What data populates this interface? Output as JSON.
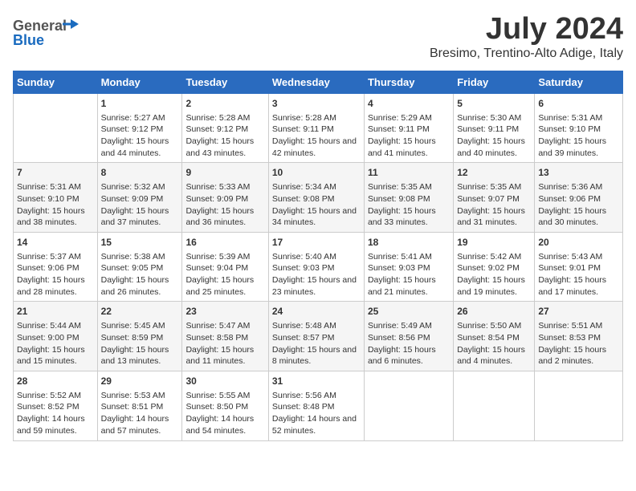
{
  "header": {
    "logo_line1": "General",
    "logo_line2": "Blue",
    "month": "July 2024",
    "location": "Bresimo, Trentino-Alto Adige, Italy"
  },
  "weekdays": [
    "Sunday",
    "Monday",
    "Tuesday",
    "Wednesday",
    "Thursday",
    "Friday",
    "Saturday"
  ],
  "weeks": [
    [
      {
        "day": "",
        "content": ""
      },
      {
        "day": "1",
        "sunrise": "Sunrise: 5:27 AM",
        "sunset": "Sunset: 9:12 PM",
        "daylight": "Daylight: 15 hours and 44 minutes."
      },
      {
        "day": "2",
        "sunrise": "Sunrise: 5:28 AM",
        "sunset": "Sunset: 9:12 PM",
        "daylight": "Daylight: 15 hours and 43 minutes."
      },
      {
        "day": "3",
        "sunrise": "Sunrise: 5:28 AM",
        "sunset": "Sunset: 9:11 PM",
        "daylight": "Daylight: 15 hours and 42 minutes."
      },
      {
        "day": "4",
        "sunrise": "Sunrise: 5:29 AM",
        "sunset": "Sunset: 9:11 PM",
        "daylight": "Daylight: 15 hours and 41 minutes."
      },
      {
        "day": "5",
        "sunrise": "Sunrise: 5:30 AM",
        "sunset": "Sunset: 9:11 PM",
        "daylight": "Daylight: 15 hours and 40 minutes."
      },
      {
        "day": "6",
        "sunrise": "Sunrise: 5:31 AM",
        "sunset": "Sunset: 9:10 PM",
        "daylight": "Daylight: 15 hours and 39 minutes."
      }
    ],
    [
      {
        "day": "7",
        "sunrise": "Sunrise: 5:31 AM",
        "sunset": "Sunset: 9:10 PM",
        "daylight": "Daylight: 15 hours and 38 minutes."
      },
      {
        "day": "8",
        "sunrise": "Sunrise: 5:32 AM",
        "sunset": "Sunset: 9:09 PM",
        "daylight": "Daylight: 15 hours and 37 minutes."
      },
      {
        "day": "9",
        "sunrise": "Sunrise: 5:33 AM",
        "sunset": "Sunset: 9:09 PM",
        "daylight": "Daylight: 15 hours and 36 minutes."
      },
      {
        "day": "10",
        "sunrise": "Sunrise: 5:34 AM",
        "sunset": "Sunset: 9:08 PM",
        "daylight": "Daylight: 15 hours and 34 minutes."
      },
      {
        "day": "11",
        "sunrise": "Sunrise: 5:35 AM",
        "sunset": "Sunset: 9:08 PM",
        "daylight": "Daylight: 15 hours and 33 minutes."
      },
      {
        "day": "12",
        "sunrise": "Sunrise: 5:35 AM",
        "sunset": "Sunset: 9:07 PM",
        "daylight": "Daylight: 15 hours and 31 minutes."
      },
      {
        "day": "13",
        "sunrise": "Sunrise: 5:36 AM",
        "sunset": "Sunset: 9:06 PM",
        "daylight": "Daylight: 15 hours and 30 minutes."
      }
    ],
    [
      {
        "day": "14",
        "sunrise": "Sunrise: 5:37 AM",
        "sunset": "Sunset: 9:06 PM",
        "daylight": "Daylight: 15 hours and 28 minutes."
      },
      {
        "day": "15",
        "sunrise": "Sunrise: 5:38 AM",
        "sunset": "Sunset: 9:05 PM",
        "daylight": "Daylight: 15 hours and 26 minutes."
      },
      {
        "day": "16",
        "sunrise": "Sunrise: 5:39 AM",
        "sunset": "Sunset: 9:04 PM",
        "daylight": "Daylight: 15 hours and 25 minutes."
      },
      {
        "day": "17",
        "sunrise": "Sunrise: 5:40 AM",
        "sunset": "Sunset: 9:03 PM",
        "daylight": "Daylight: 15 hours and 23 minutes."
      },
      {
        "day": "18",
        "sunrise": "Sunrise: 5:41 AM",
        "sunset": "Sunset: 9:03 PM",
        "daylight": "Daylight: 15 hours and 21 minutes."
      },
      {
        "day": "19",
        "sunrise": "Sunrise: 5:42 AM",
        "sunset": "Sunset: 9:02 PM",
        "daylight": "Daylight: 15 hours and 19 minutes."
      },
      {
        "day": "20",
        "sunrise": "Sunrise: 5:43 AM",
        "sunset": "Sunset: 9:01 PM",
        "daylight": "Daylight: 15 hours and 17 minutes."
      }
    ],
    [
      {
        "day": "21",
        "sunrise": "Sunrise: 5:44 AM",
        "sunset": "Sunset: 9:00 PM",
        "daylight": "Daylight: 15 hours and 15 minutes."
      },
      {
        "day": "22",
        "sunrise": "Sunrise: 5:45 AM",
        "sunset": "Sunset: 8:59 PM",
        "daylight": "Daylight: 15 hours and 13 minutes."
      },
      {
        "day": "23",
        "sunrise": "Sunrise: 5:47 AM",
        "sunset": "Sunset: 8:58 PM",
        "daylight": "Daylight: 15 hours and 11 minutes."
      },
      {
        "day": "24",
        "sunrise": "Sunrise: 5:48 AM",
        "sunset": "Sunset: 8:57 PM",
        "daylight": "Daylight: 15 hours and 8 minutes."
      },
      {
        "day": "25",
        "sunrise": "Sunrise: 5:49 AM",
        "sunset": "Sunset: 8:56 PM",
        "daylight": "Daylight: 15 hours and 6 minutes."
      },
      {
        "day": "26",
        "sunrise": "Sunrise: 5:50 AM",
        "sunset": "Sunset: 8:54 PM",
        "daylight": "Daylight: 15 hours and 4 minutes."
      },
      {
        "day": "27",
        "sunrise": "Sunrise: 5:51 AM",
        "sunset": "Sunset: 8:53 PM",
        "daylight": "Daylight: 15 hours and 2 minutes."
      }
    ],
    [
      {
        "day": "28",
        "sunrise": "Sunrise: 5:52 AM",
        "sunset": "Sunset: 8:52 PM",
        "daylight": "Daylight: 14 hours and 59 minutes."
      },
      {
        "day": "29",
        "sunrise": "Sunrise: 5:53 AM",
        "sunset": "Sunset: 8:51 PM",
        "daylight": "Daylight: 14 hours and 57 minutes."
      },
      {
        "day": "30",
        "sunrise": "Sunrise: 5:55 AM",
        "sunset": "Sunset: 8:50 PM",
        "daylight": "Daylight: 14 hours and 54 minutes."
      },
      {
        "day": "31",
        "sunrise": "Sunrise: 5:56 AM",
        "sunset": "Sunset: 8:48 PM",
        "daylight": "Daylight: 14 hours and 52 minutes."
      },
      {
        "day": "",
        "content": ""
      },
      {
        "day": "",
        "content": ""
      },
      {
        "day": "",
        "content": ""
      }
    ]
  ]
}
